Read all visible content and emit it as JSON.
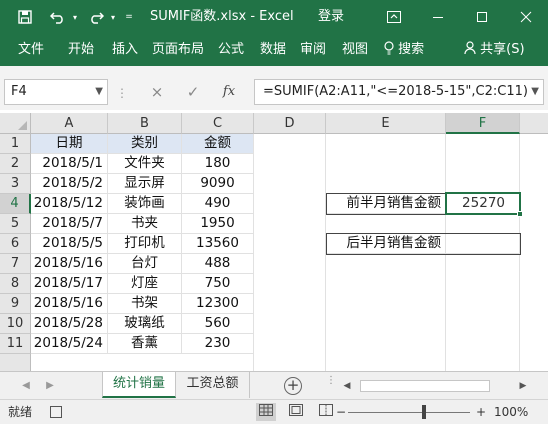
{
  "window": {
    "title": "SUMIF函数.xlsx  -  Excel",
    "login": "登录",
    "save_icon": "save-icon",
    "undo_icon": "undo-icon",
    "redo_icon": "redo-icon",
    "customize_icon": "customize-quick-access-icon"
  },
  "ribbon": {
    "tabs": [
      "文件",
      "开始",
      "插入",
      "页面布局",
      "公式",
      "数据",
      "审阅",
      "视图"
    ],
    "tell_me": "搜索",
    "share": "共享(S)"
  },
  "formula_bar": {
    "name_box": "F4",
    "cancel_icon": "×",
    "enter_icon": "✓",
    "fx_label": "fx",
    "formula": "=SUMIF(A2:A11,\"<=2018-5-15\",C2:C11)"
  },
  "grid": {
    "columns": [
      "A",
      "B",
      "C",
      "D",
      "E",
      "F"
    ],
    "selected_column": "F",
    "rows": [
      "1",
      "2",
      "3",
      "4",
      "5",
      "6",
      "7",
      "8",
      "9",
      "10",
      "11"
    ],
    "selected_row": "4",
    "headers": {
      "date": "日期",
      "category": "类别",
      "amount": "金额"
    },
    "records": [
      {
        "date": "2018/5/1",
        "category": "文件夹",
        "amount": "180"
      },
      {
        "date": "2018/5/2",
        "category": "显示屏",
        "amount": "9090"
      },
      {
        "date": "2018/5/12",
        "category": "装饰画",
        "amount": "490"
      },
      {
        "date": "2018/5/7",
        "category": "书夹",
        "amount": "1950"
      },
      {
        "date": "2018/5/5",
        "category": "打印机",
        "amount": "13560"
      },
      {
        "date": "2018/5/16",
        "category": "台灯",
        "amount": "488"
      },
      {
        "date": "2018/5/17",
        "category": "灯座",
        "amount": "750"
      },
      {
        "date": "2018/5/16",
        "category": "书架",
        "amount": "12300"
      },
      {
        "date": "2018/5/28",
        "category": "玻璃纸",
        "amount": "560"
      },
      {
        "date": "2018/5/24",
        "category": "香薰",
        "amount": "230"
      }
    ],
    "summary": [
      {
        "label": "前半月销售金额",
        "value": "25270"
      },
      {
        "label": "后半月销售金额",
        "value": ""
      }
    ]
  },
  "sheets": {
    "tabs": [
      "统计销量",
      "工资总额"
    ],
    "active": "统计销量",
    "add_label": "+"
  },
  "status": {
    "ready": "就绪",
    "zoom_minus": "−",
    "zoom_plus": "+",
    "zoom": "100%"
  },
  "colors": {
    "accent": "#217346",
    "header_fill": "#dde6f3"
  }
}
